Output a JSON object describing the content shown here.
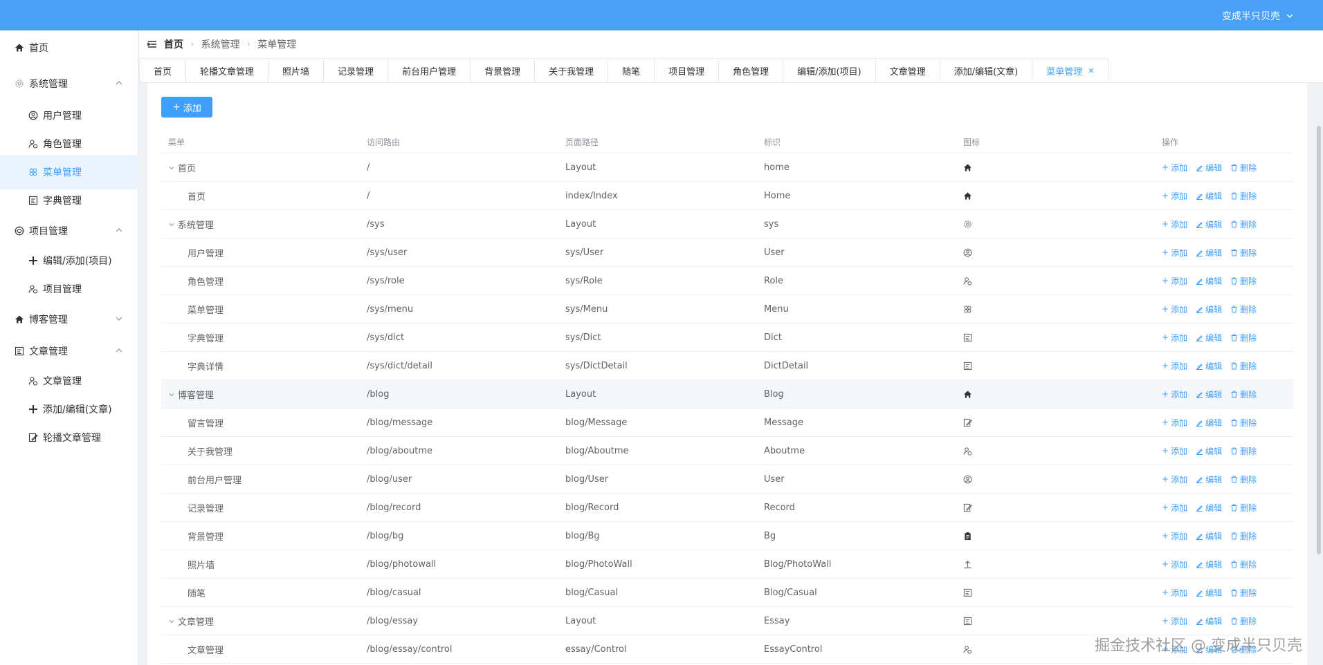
{
  "header": {
    "user": "变成半只贝壳"
  },
  "sidebar": [
    {
      "label": "首页",
      "icon": "home-icon",
      "level": 1
    },
    {
      "label": "系统管理",
      "icon": "gear-icon",
      "level": 1,
      "caret": "up"
    },
    {
      "label": "用户管理",
      "icon": "user-circle-icon",
      "level": 2
    },
    {
      "label": "角色管理",
      "icon": "user-settings-icon",
      "level": 2
    },
    {
      "label": "菜单管理",
      "icon": "menu-flower-icon",
      "level": 2,
      "active": true
    },
    {
      "label": "字典管理",
      "icon": "notebook-icon",
      "level": 2
    },
    {
      "label": "项目管理",
      "icon": "cog-badge-icon",
      "level": 1,
      "caret": "up"
    },
    {
      "label": "编辑/添加(项目)",
      "icon": "plus-icon",
      "level": 2
    },
    {
      "label": "项目管理",
      "icon": "user-settings-icon",
      "level": 2
    },
    {
      "label": "博客管理",
      "icon": "home-icon",
      "level": 1,
      "caret": "down"
    },
    {
      "label": "文章管理",
      "icon": "notebook-icon",
      "level": 1,
      "caret": "up"
    },
    {
      "label": "文章管理",
      "icon": "user-settings-icon",
      "level": 2
    },
    {
      "label": "添加/编辑(文章)",
      "icon": "plus-icon",
      "level": 2
    },
    {
      "label": "轮播文章管理",
      "icon": "edit-doc-icon",
      "level": 2
    }
  ],
  "breadcrumb": [
    "首页",
    "系统管理",
    "菜单管理"
  ],
  "tabs": [
    "首页",
    "轮播文章管理",
    "照片墙",
    "记录管理",
    "前台用户管理",
    "背景管理",
    "关于我管理",
    "随笔",
    "项目管理",
    "角色管理",
    "编辑/添加(项目)",
    "文章管理",
    "添加/编辑(文章)",
    "菜单管理"
  ],
  "active_tab": "菜单管理",
  "add_button": "添加",
  "table": {
    "headers": [
      "菜单",
      "访问路由",
      "页面路径",
      "标识",
      "图标",
      "操作"
    ],
    "op_labels": {
      "add": "添加",
      "edit": "编辑",
      "delete": "删除"
    },
    "rows": [
      {
        "menu": "首页",
        "route": "/",
        "path": "Layout",
        "key": "home",
        "icon": "home-icon",
        "parent": true
      },
      {
        "menu": "首页",
        "route": "/",
        "path": "index/Index",
        "key": "Home",
        "icon": "home-icon",
        "parent": false
      },
      {
        "menu": "系统管理",
        "route": "/sys",
        "path": "Layout",
        "key": "sys",
        "icon": "gear-icon",
        "parent": true
      },
      {
        "menu": "用户管理",
        "route": "/sys/user",
        "path": "sys/User",
        "key": "User",
        "icon": "user-circle-icon",
        "parent": false
      },
      {
        "menu": "角色管理",
        "route": "/sys/role",
        "path": "sys/Role",
        "key": "Role",
        "icon": "user-settings-icon",
        "parent": false
      },
      {
        "menu": "菜单管理",
        "route": "/sys/menu",
        "path": "sys/Menu",
        "key": "Menu",
        "icon": "menu-flower-icon",
        "parent": false
      },
      {
        "menu": "字典管理",
        "route": "/sys/dict",
        "path": "sys/Dict",
        "key": "Dict",
        "icon": "notebook-icon",
        "parent": false
      },
      {
        "menu": "字典详情",
        "route": "/sys/dict/detail",
        "path": "sys/DictDetail",
        "key": "DictDetail",
        "icon": "notebook-icon",
        "parent": false
      },
      {
        "menu": "博客管理",
        "route": "/blog",
        "path": "Layout",
        "key": "Blog",
        "icon": "home-icon",
        "parent": true,
        "hover": true
      },
      {
        "menu": "留言管理",
        "route": "/blog/message",
        "path": "blog/Message",
        "key": "Message",
        "icon": "edit-doc-icon",
        "parent": false
      },
      {
        "menu": "关于我管理",
        "route": "/blog/aboutme",
        "path": "blog/Aboutme",
        "key": "Aboutme",
        "icon": "user-settings-icon",
        "parent": false
      },
      {
        "menu": "前台用户管理",
        "route": "/blog/user",
        "path": "blog/User",
        "key": "User",
        "icon": "user-circle-icon",
        "parent": false
      },
      {
        "menu": "记录管理",
        "route": "/blog/record",
        "path": "blog/Record",
        "key": "Record",
        "icon": "edit-doc-icon",
        "parent": false
      },
      {
        "menu": "背景管理",
        "route": "/blog/bg",
        "path": "blog/Bg",
        "key": "Bg",
        "icon": "clipboard-icon",
        "parent": false
      },
      {
        "menu": "照片墙",
        "route": "/blog/photowall",
        "path": "blog/PhotoWall",
        "key": "Blog/PhotoWall",
        "icon": "upload-icon",
        "parent": false
      },
      {
        "menu": "随笔",
        "route": "/blog/casual",
        "path": "blog/Casual",
        "key": "Blog/Casual",
        "icon": "notebook-icon",
        "parent": false
      },
      {
        "menu": "文章管理",
        "route": "/blog/essay",
        "path": "Layout",
        "key": "Essay",
        "icon": "notebook-icon",
        "parent": true
      },
      {
        "menu": "文章管理",
        "route": "/blog/essay/control",
        "path": "essay/Control",
        "key": "EssayControl",
        "icon": "user-settings-icon",
        "parent": false
      }
    ]
  },
  "watermark": "掘金技术社区 @ 变成半只贝壳",
  "colors": {
    "primary": "#409eff",
    "topbar": "#4aa0f7"
  }
}
